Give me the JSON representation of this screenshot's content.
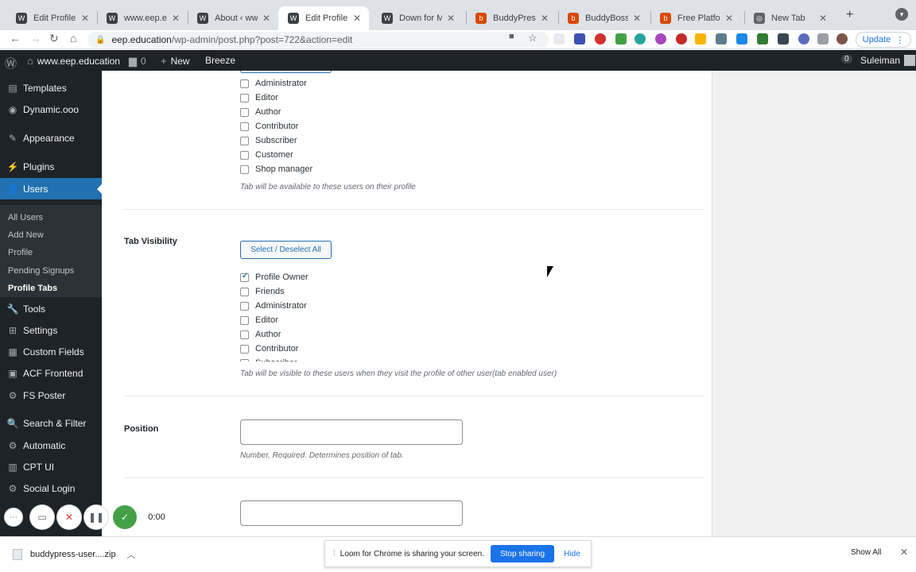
{
  "browser": {
    "tabs": [
      {
        "title": "Edit Profile Tab",
        "icon": "wordpress-icon",
        "color": "#3c4043"
      },
      {
        "title": "www.eep.educ",
        "icon": "wordpress-icon",
        "color": "#3c4043"
      },
      {
        "title": "About ‹ www.e",
        "icon": "wordpress-icon",
        "color": "#3c4043"
      },
      {
        "title": "Edit Profile Tab",
        "icon": "wordpress-icon",
        "color": "#3c4043"
      },
      {
        "title": "Down for Main",
        "icon": "wordpress-icon",
        "color": "#3c4043"
      },
      {
        "title": "BuddyPress U",
        "icon": "buddypress-icon",
        "color": "#d84800"
      },
      {
        "title": "BuddyBoss – ",
        "icon": "buddypress-icon",
        "color": "#d84800"
      },
      {
        "title": "Free Platform",
        "icon": "buddypress-icon",
        "color": "#d84800"
      },
      {
        "title": "New Tab",
        "icon": "chrome-icon",
        "color": "#5f6368"
      }
    ],
    "url_domain": "eep.education",
    "url_path": "/wp-admin/post.php?post=722&action=edit",
    "update_label": "Update"
  },
  "adminbar": {
    "site_name": "www.eep.education",
    "comments": "0",
    "new_label": "New",
    "breeze": "Breeze",
    "notif": "0",
    "user": "Suleiman"
  },
  "menu": [
    {
      "label": "Templates",
      "icon": "▤"
    },
    {
      "label": "Dynamic.ooo",
      "icon": "◉"
    },
    {
      "label": "Appearance",
      "icon": "✎"
    },
    {
      "label": "Plugins",
      "icon": "⚡"
    },
    {
      "label": "Users",
      "icon": "👤"
    },
    {
      "label": "Tools",
      "icon": "🔧"
    },
    {
      "label": "Settings",
      "icon": "⊞"
    },
    {
      "label": "Custom Fields",
      "icon": "▦"
    },
    {
      "label": "ACF Frontend",
      "icon": "▣"
    },
    {
      "label": "FS Poster",
      "icon": "⚙"
    },
    {
      "label": "Search & Filter",
      "icon": "🔍"
    },
    {
      "label": "Automatic",
      "icon": "⚙"
    },
    {
      "label": "CPT UI",
      "icon": "▥"
    },
    {
      "label": "Social Login",
      "icon": "⚙"
    }
  ],
  "users_submenu": [
    "All Users",
    "Add New",
    "Profile",
    "Pending Signups",
    "Profile Tabs"
  ],
  "available": {
    "roles": [
      "Administrator",
      "Editor",
      "Author",
      "Contributor",
      "Subscriber",
      "Customer",
      "Shop manager"
    ],
    "description": "Tab will be available to these users on their profile"
  },
  "visibility": {
    "label": "Tab Visibility",
    "select_all": "Select / Deselect All",
    "options": [
      {
        "label": "Profile Owner",
        "checked": true
      },
      {
        "label": "Friends",
        "checked": false
      },
      {
        "label": "Administrator",
        "checked": false
      },
      {
        "label": "Editor",
        "checked": false
      },
      {
        "label": "Author",
        "checked": false
      },
      {
        "label": "Contributor",
        "checked": false
      },
      {
        "label": "Subscriber",
        "checked": false
      }
    ],
    "description": "Tab will be visible to these users when they visit the profile of other user(tab enabled user)"
  },
  "position": {
    "label": "Position",
    "value": "",
    "description": "Number, Required. Determines position of tab."
  },
  "loom": {
    "time": "0:00"
  },
  "download": {
    "filename": "buddypress-user....zip",
    "show_all": "Show All"
  },
  "share_bar": {
    "message": "Loom for Chrome is sharing your screen.",
    "stop": "Stop sharing",
    "hide": "Hide"
  }
}
